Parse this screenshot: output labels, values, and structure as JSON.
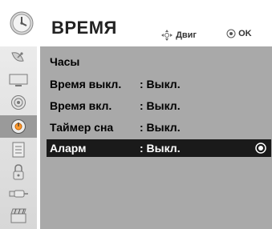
{
  "header": {
    "title": "ВРЕМЯ",
    "move_hint": "Двиг",
    "ok_hint": "OK",
    "clock_icon": "clock-icon"
  },
  "sidebar": {
    "items": [
      {
        "icon": "satellite-dish-icon",
        "active": false
      },
      {
        "icon": "tv-screen-icon",
        "active": false
      },
      {
        "icon": "speaker-icon",
        "active": false
      },
      {
        "icon": "clock-icon",
        "active": true
      },
      {
        "icon": "list-icon",
        "active": false
      },
      {
        "icon": "lock-icon",
        "active": false
      },
      {
        "icon": "usb-icon",
        "active": false
      },
      {
        "icon": "clapper-icon",
        "active": false
      }
    ]
  },
  "menu": {
    "rows": [
      {
        "label": "Часы",
        "value": ""
      },
      {
        "label": "Время выкл.",
        "value": ": Выкл."
      },
      {
        "label": "Время вкл.",
        "value": ": Выкл."
      },
      {
        "label": "Таймер сна",
        "value": ": Выкл."
      },
      {
        "label": "Аларм",
        "value": ": Выкл.",
        "selected": true
      }
    ]
  },
  "colors": {
    "panel_bg": "#a9a9a9",
    "selected_bg": "#1a1a1a",
    "selected_text": "#ffffff",
    "sidebar_active": "#9a9a9a"
  }
}
